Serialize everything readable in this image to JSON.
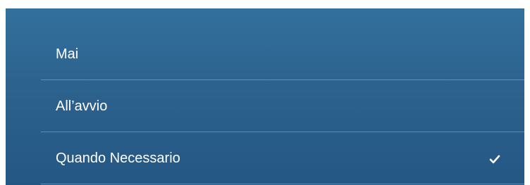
{
  "options": [
    {
      "label": "Mai",
      "selected": false
    },
    {
      "label": "All’avvio",
      "selected": false
    },
    {
      "label": "Quando Necessario",
      "selected": true
    }
  ],
  "check_icon": "checkmark-icon"
}
